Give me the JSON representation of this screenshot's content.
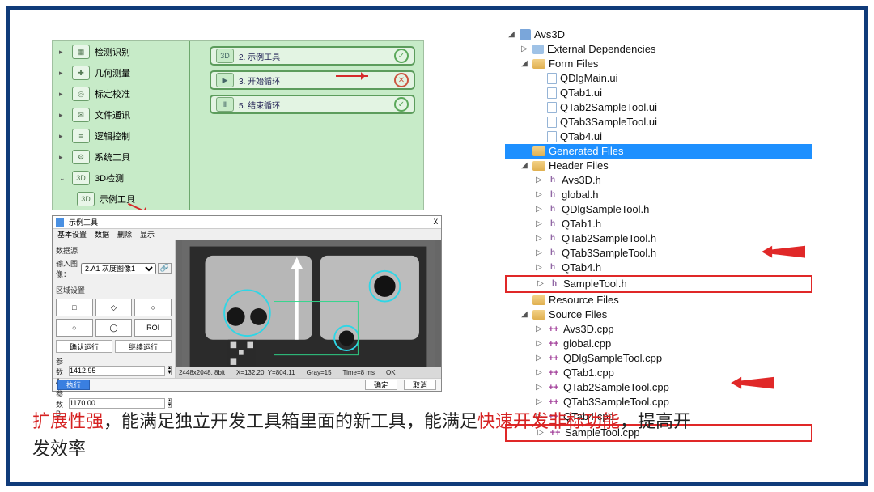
{
  "green_panel": {
    "left_items": [
      {
        "label": "检测识别",
        "expand": "▸",
        "icon": "▦"
      },
      {
        "label": "几何测量",
        "expand": "▸",
        "icon": "✚"
      },
      {
        "label": "标定校准",
        "expand": "▸",
        "icon": "◎"
      },
      {
        "label": "文件通讯",
        "expand": "▸",
        "icon": "✉"
      },
      {
        "label": "逻辑控制",
        "expand": "▸",
        "icon": "≡"
      },
      {
        "label": "系统工具",
        "expand": "▸",
        "icon": "⚙"
      },
      {
        "label": "3D检测",
        "expand": "⌄",
        "icon": "3D"
      }
    ],
    "left_subitem": {
      "label": "示例工具",
      "icon": "3D"
    },
    "steps": [
      {
        "icon": "3D",
        "label": "2. 示例工具",
        "status": "ok"
      },
      {
        "icon": "▶",
        "label": "3. 开始循环",
        "status": "err"
      },
      {
        "icon": "Ⅱ",
        "label": "5. 结束循环",
        "status": "ok"
      }
    ]
  },
  "tool_dlg": {
    "title": "示例工具",
    "close": "X",
    "menu": [
      "基本设置",
      "数据",
      "删除",
      "显示"
    ],
    "tabs_label": "数据源",
    "input_label": "输入图像：",
    "input_select": "2.A1 灰度图像1",
    "section_roi": "区域设置",
    "shapes": [
      "□",
      "◇",
      "○",
      "○",
      "◯",
      "ROI"
    ],
    "run_btns": [
      "确认运行",
      "继续运行"
    ],
    "params": [
      {
        "label": "参数A",
        "value": "1412.95"
      },
      {
        "label": "参数B",
        "value": "1170.00"
      }
    ],
    "foot_left": "执行",
    "foot_btns": [
      "确定",
      "取消"
    ],
    "status": {
      "dim": "2448x2048, 8bit",
      "pos": "X=132.20, Y=804.11",
      "gray": "Gray=15",
      "time": "Time=8 ms",
      "ok": "OK"
    }
  },
  "tree": {
    "root": "Avs3D",
    "ext": "External Dependencies",
    "form_files": "Form Files",
    "forms": [
      "QDlgMain.ui",
      "QTab1.ui",
      "QTab2SampleTool.ui",
      "QTab3SampleTool.ui",
      "QTab4.ui"
    ],
    "gen": "Generated Files",
    "hdr_folder": "Header Files",
    "hdrs": [
      "Avs3D.h",
      "global.h",
      "QDlgSampleTool.h",
      "QTab1.h",
      "QTab2SampleTool.h",
      "QTab3SampleTool.h",
      "QTab4.h",
      "SampleTool.h"
    ],
    "res": "Resource Files",
    "src_folder": "Source Files",
    "srcs": [
      "Avs3D.cpp",
      "global.cpp",
      "QDlgSampleTool.cpp",
      "QTab1.cpp",
      "QTab2SampleTool.cpp",
      "QTab3SampleTool.cpp",
      "QTab4.cpp",
      "SampleTool.cpp"
    ]
  },
  "caption": {
    "p1a": "扩展性强",
    "p1b": "，能满足独立开发工具箱里面的新工具，能满足",
    "p1c": "快速开发非标功能",
    "p1d": "，提高开",
    "p2": "发效率"
  }
}
